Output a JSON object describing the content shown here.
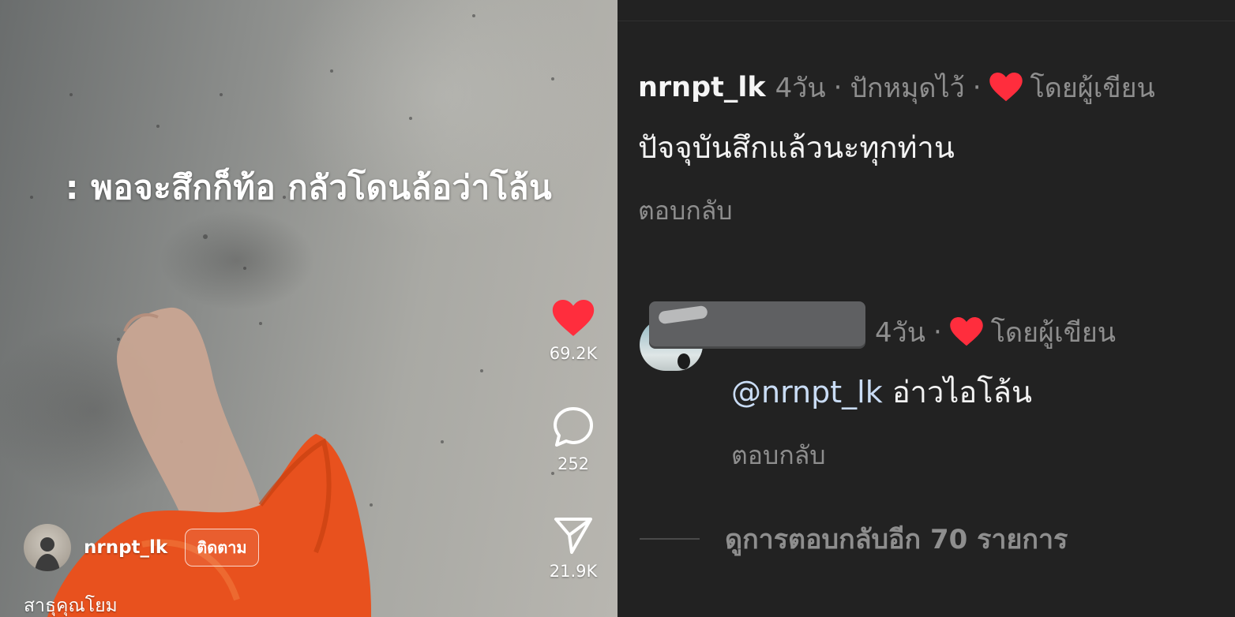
{
  "video": {
    "caption": ": พอจะสึกก็ท้อ กลัวโดนล้อว่าโล้น",
    "likes": "69.2K",
    "comments": "252",
    "shares": "21.9K",
    "author": "nrnpt_lk",
    "follow_label": "ติดตาม",
    "description": "สาธุคุณโยม",
    "icons": {
      "like": "heart-icon",
      "comment": "comment-bubble-icon",
      "share": "send-icon"
    },
    "colors": {
      "like": "#ff2d3d",
      "robe": "#e8511e"
    }
  },
  "comments": {
    "pinned": {
      "username": "nrnpt_lk",
      "time": "4วัน",
      "sep1": "·",
      "pinned_label": "ปักหมุดไว้",
      "sep2": "·",
      "liked_by_creator": "โดยผู้เขียน",
      "text": "ปัจจุบันสึกแล้วนะทุกท่าน",
      "reply_label": "ตอบกลับ"
    },
    "reply": {
      "time": "4วัน",
      "sep1": "·",
      "liked_by_creator": "โดยผู้เขียน",
      "mention": "@nrnpt_lk",
      "text": "อ่าวไอโล้น",
      "reply_label": "ตอบกลับ"
    },
    "view_more_replies": "ดูการตอบกลับอีก 70 รายการ",
    "colors": {
      "heart": "#ff2d3d",
      "mention": "#c9dcf5"
    }
  }
}
